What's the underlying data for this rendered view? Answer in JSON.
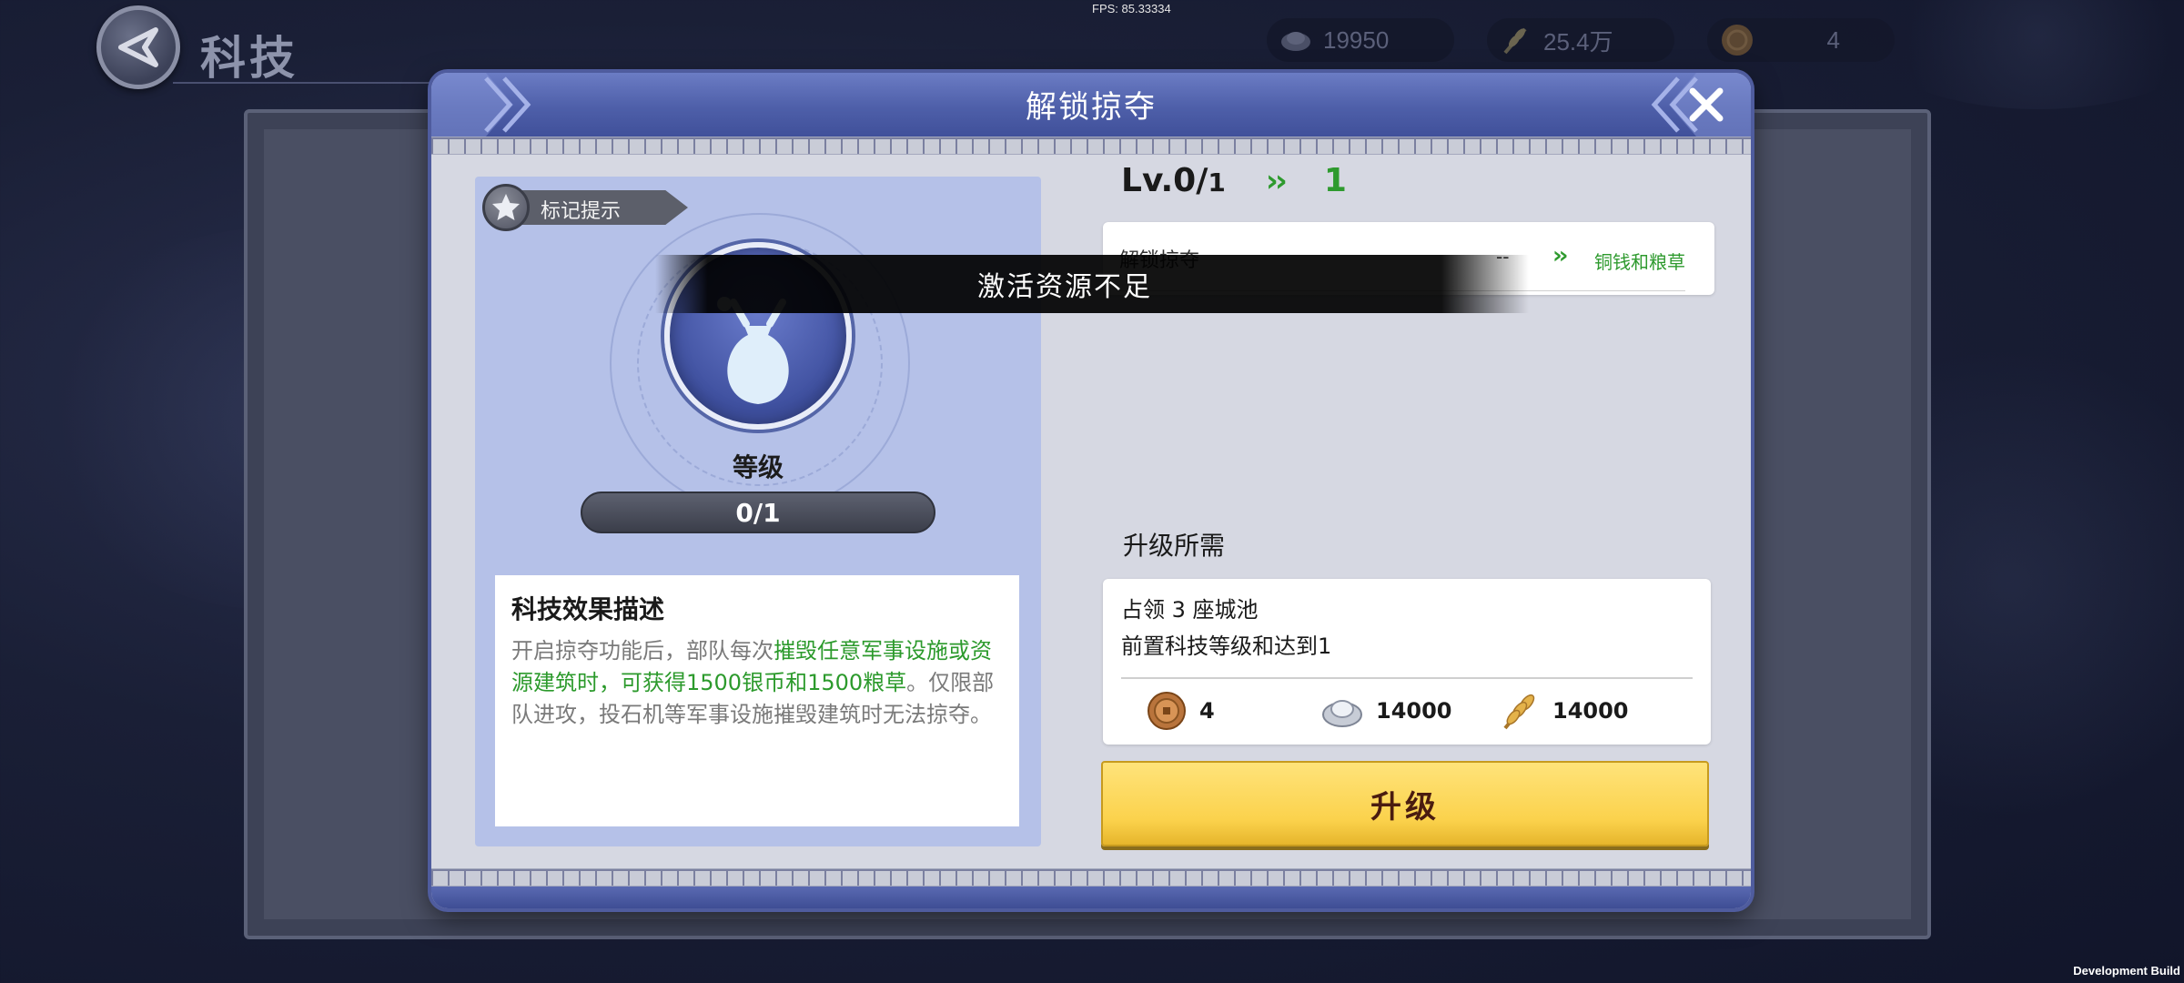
{
  "fps_text": "FPS: 85.33334",
  "page_title": "科技",
  "resources": {
    "silver": "19950",
    "grain": "25.4万",
    "copper": "4"
  },
  "modal": {
    "title": "解锁掠夺",
    "mark_tag_label": "标记提示",
    "level_label": "等级",
    "level_value": "0/1",
    "desc_title": "科技效果描述",
    "desc_part1": "开启掠夺功能后，部队每次",
    "desc_highlight": "摧毁任意军事设施或资源建筑时，可获得1500银币和1500粮草",
    "desc_part2": "。仅限部队进攻，投石机等军事设施摧毁建筑时无法掠夺。",
    "lv_prefix": "Lv.0/",
    "lv_max": "1",
    "lv_arrow": "››",
    "lv_next": "1",
    "effect_name": "解锁掠夺",
    "effect_current": "--",
    "effect_arrow": "››",
    "effect_next": "铜钱和粮草",
    "requirements_title": "升级所需",
    "req_line1": "占领 3 座城池",
    "req_line2": "前置科技等级和达到1",
    "costs": {
      "copper": "4",
      "silver": "14000",
      "grain": "14000"
    },
    "upgrade_label": "升级"
  },
  "toast_text": "激活资源不足",
  "dev_build_label": "Development Build",
  "icons": {
    "back": "back-arrow-icon",
    "close": "close-icon",
    "star": "star-icon",
    "emblem": "money-bag-icon",
    "silver": "silver-ingot-icon",
    "grain": "wheat-icon",
    "copper": "copper-coin-icon"
  },
  "colors": {
    "header_blue": "#4e5fa9",
    "highlight_green": "#2c9a2c",
    "upgrade_yellow": "#fbd24c",
    "left_panel": "#b5c1e8"
  }
}
